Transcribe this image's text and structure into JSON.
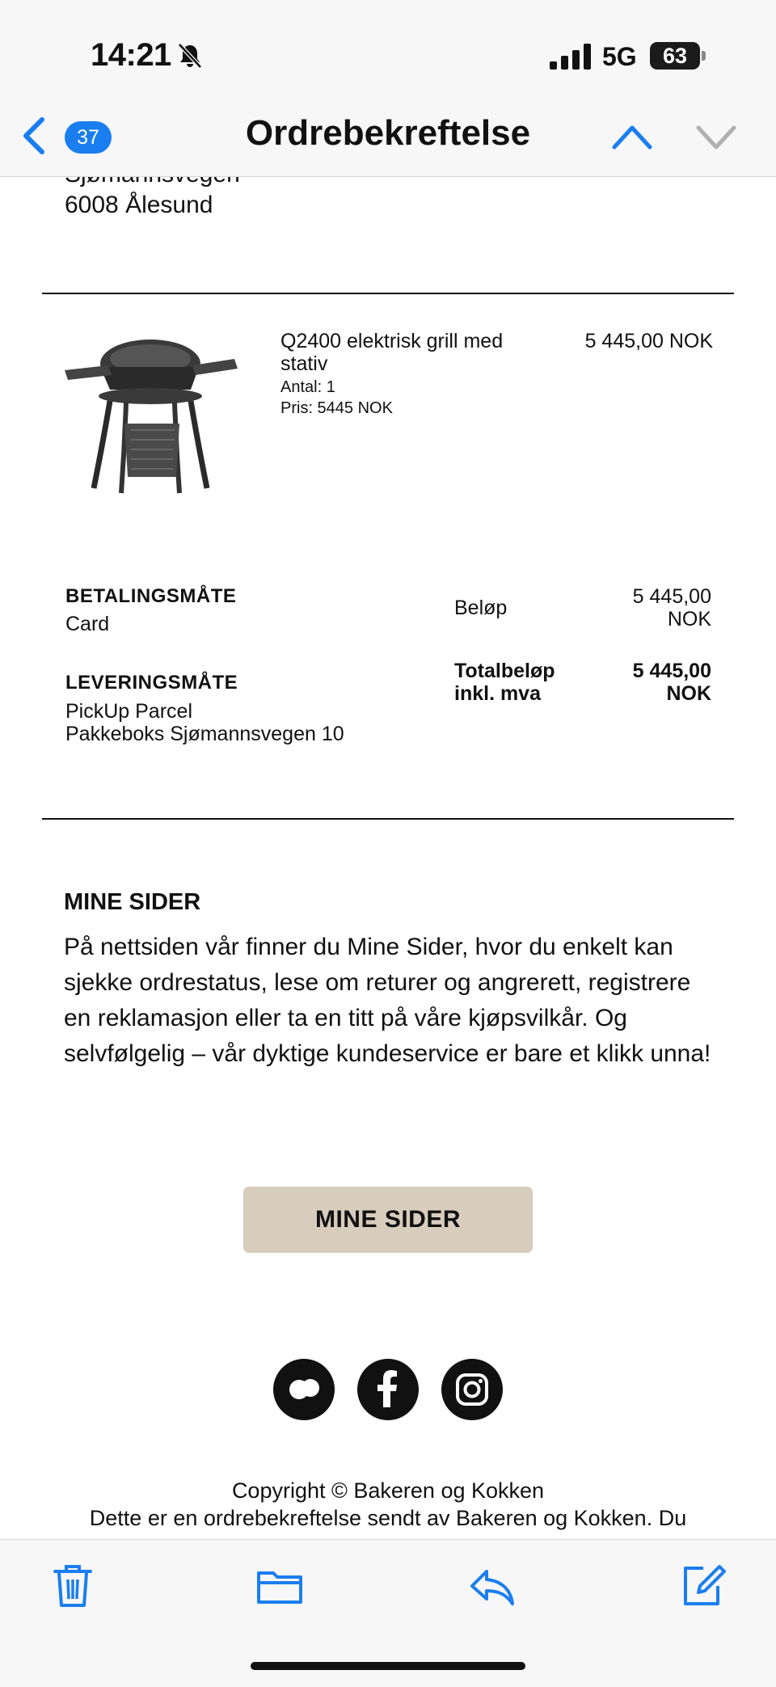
{
  "status_bar": {
    "time": "14:21",
    "network": "5G",
    "battery": "63"
  },
  "header": {
    "back_count": "37",
    "title": "Ordrebekreftelse"
  },
  "address": {
    "street": "Sjømannsvegen",
    "city": "6008 Ålesund"
  },
  "order_item": {
    "name": "Q2400 elektrisk grill med stativ",
    "quantity": "Antal: 1",
    "unit_price": "Pris: 5445 NOK",
    "line_total": "5 445,00 NOK"
  },
  "payment": {
    "label": "BETALINGSMÅTE",
    "value": "Card"
  },
  "delivery": {
    "label": "LEVERINGSMÅTE",
    "method": "PickUp Parcel",
    "location": "Pakkeboks Sjømannsvegen 10"
  },
  "summary": {
    "amount_label": "Beløp",
    "amount_value_line1": "5 445,00",
    "amount_value_line2": "NOK",
    "total_label_line1": "Totalbeløp",
    "total_label_line2": "inkl. mva",
    "total_value_line1": "5 445,00",
    "total_value_line2": "NOK"
  },
  "mine_sider": {
    "heading": "MINE SIDER",
    "body": "På nettsiden vår finner du Mine Sider, hvor du enkelt kan sjekke ordrestatus, lese om returer og angrerett, registrere en reklamasjon eller ta en titt på våre kjøpsvilkår. Og selvfølgelig – vår dyktige kundeservice er bare et klikk unna!",
    "button_label": "MINE SIDER"
  },
  "footer": {
    "copyright": "Copyright © Bakeren og Kokken",
    "note": "Dette er en ordrebekreftelse sendt av Bakeren og Kokken. Du"
  },
  "colors": {
    "accent": "#1a7ef0",
    "button_bg": "#d8cdbd",
    "toolbar_bg": "#f7f7f7"
  },
  "icons": [
    "bell-slash-icon",
    "signal-icon",
    "battery-icon",
    "chevron-left-icon",
    "chevron-up-icon",
    "chevron-down-icon",
    "trash-icon",
    "folder-icon",
    "reply-icon",
    "compose-icon",
    "chat-icon",
    "facebook-icon",
    "instagram-icon"
  ]
}
